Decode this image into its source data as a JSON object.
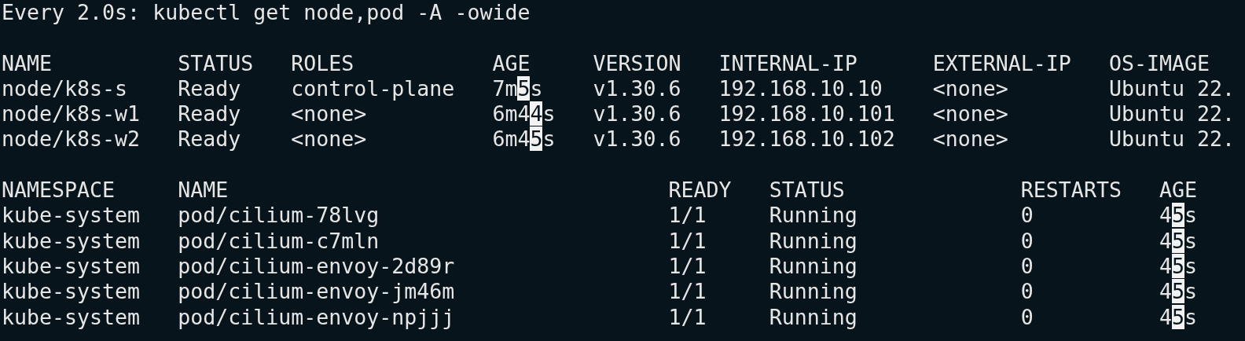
{
  "command_line": "Every 2.0s: kubectl get node,pod -A -owide",
  "node_table": {
    "columns": [
      "NAME",
      "STATUS",
      "ROLES",
      "AGE",
      "VERSION",
      "INTERNAL-IP",
      "EXTERNAL-IP",
      "OS-IMAGE"
    ],
    "rows": [
      {
        "cells": [
          "node/k8s-s",
          "Ready",
          "control-plane",
          [
            {
              "text": "7m",
              "changed": false
            },
            {
              "text": "5",
              "changed": true
            },
            {
              "text": "s",
              "changed": false
            }
          ],
          "v1.30.6",
          "192.168.10.10",
          "<none>",
          "Ubuntu 22."
        ]
      },
      {
        "cells": [
          "node/k8s-w1",
          "Ready",
          "<none>",
          [
            {
              "text": "6m4",
              "changed": false
            },
            {
              "text": "4",
              "changed": true
            },
            {
              "text": "s",
              "changed": false
            }
          ],
          "v1.30.6",
          "192.168.10.101",
          "<none>",
          "Ubuntu 22."
        ]
      },
      {
        "cells": [
          "node/k8s-w2",
          "Ready",
          "<none>",
          [
            {
              "text": "6m4",
              "changed": false
            },
            {
              "text": "5",
              "changed": true
            },
            {
              "text": "s",
              "changed": false
            }
          ],
          "v1.30.6",
          "192.168.10.102",
          "<none>",
          "Ubuntu 22."
        ]
      }
    ]
  },
  "pod_table": {
    "columns": [
      "NAMESPACE",
      "NAME",
      "READY",
      "STATUS",
      "RESTARTS",
      "AGE"
    ],
    "rows": [
      {
        "cells": [
          "kube-system",
          "pod/cilium-78lvg",
          "1/1",
          "Running",
          "0",
          [
            {
              "text": "4",
              "changed": false
            },
            {
              "text": "5",
              "changed": true
            },
            {
              "text": "s",
              "changed": false
            }
          ]
        ]
      },
      {
        "cells": [
          "kube-system",
          "pod/cilium-c7mln",
          "1/1",
          "Running",
          "0",
          [
            {
              "text": "4",
              "changed": false
            },
            {
              "text": "5",
              "changed": true
            },
            {
              "text": "s",
              "changed": false
            }
          ]
        ]
      },
      {
        "cells": [
          "kube-system",
          "pod/cilium-envoy-2d89r",
          "1/1",
          "Running",
          "0",
          [
            {
              "text": "4",
              "changed": false
            },
            {
              "text": "5",
              "changed": true
            },
            {
              "text": "s",
              "changed": false
            }
          ]
        ]
      },
      {
        "cells": [
          "kube-system",
          "pod/cilium-envoy-jm46m",
          "1/1",
          "Running",
          "0",
          [
            {
              "text": "4",
              "changed": false
            },
            {
              "text": "5",
              "changed": true
            },
            {
              "text": "s",
              "changed": false
            }
          ]
        ]
      },
      {
        "cells": [
          "kube-system",
          "pod/cilium-envoy-npjjj",
          "1/1",
          "Running",
          "0",
          [
            {
              "text": "4",
              "changed": false
            },
            {
              "text": "5",
              "changed": true
            },
            {
              "text": "s",
              "changed": false
            }
          ]
        ]
      }
    ]
  }
}
